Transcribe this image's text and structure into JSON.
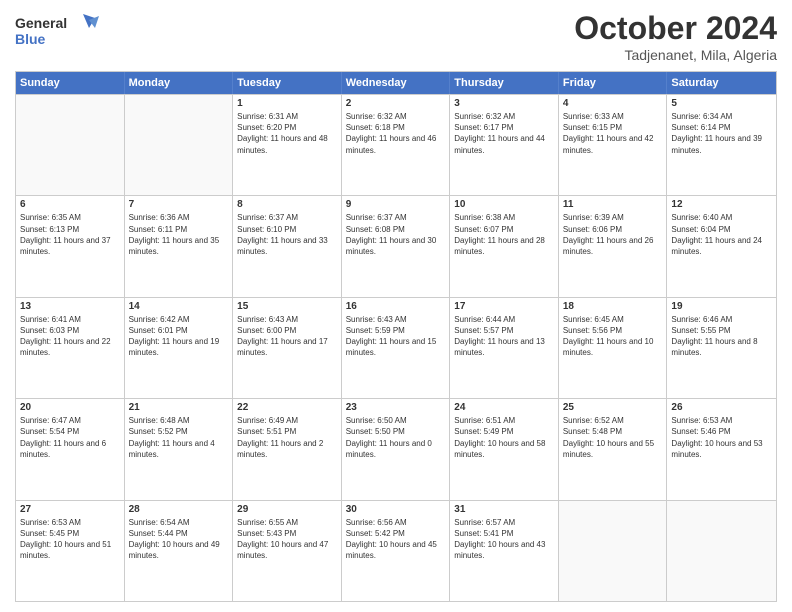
{
  "header": {
    "logo_line1": "General",
    "logo_line2": "Blue",
    "month": "October 2024",
    "location": "Tadjenanet, Mila, Algeria"
  },
  "weekdays": [
    "Sunday",
    "Monday",
    "Tuesday",
    "Wednesday",
    "Thursday",
    "Friday",
    "Saturday"
  ],
  "rows": [
    [
      {
        "day": "",
        "sunrise": "",
        "sunset": "",
        "daylight": ""
      },
      {
        "day": "",
        "sunrise": "",
        "sunset": "",
        "daylight": ""
      },
      {
        "day": "1",
        "sunrise": "Sunrise: 6:31 AM",
        "sunset": "Sunset: 6:20 PM",
        "daylight": "Daylight: 11 hours and 48 minutes."
      },
      {
        "day": "2",
        "sunrise": "Sunrise: 6:32 AM",
        "sunset": "Sunset: 6:18 PM",
        "daylight": "Daylight: 11 hours and 46 minutes."
      },
      {
        "day": "3",
        "sunrise": "Sunrise: 6:32 AM",
        "sunset": "Sunset: 6:17 PM",
        "daylight": "Daylight: 11 hours and 44 minutes."
      },
      {
        "day": "4",
        "sunrise": "Sunrise: 6:33 AM",
        "sunset": "Sunset: 6:15 PM",
        "daylight": "Daylight: 11 hours and 42 minutes."
      },
      {
        "day": "5",
        "sunrise": "Sunrise: 6:34 AM",
        "sunset": "Sunset: 6:14 PM",
        "daylight": "Daylight: 11 hours and 39 minutes."
      }
    ],
    [
      {
        "day": "6",
        "sunrise": "Sunrise: 6:35 AM",
        "sunset": "Sunset: 6:13 PM",
        "daylight": "Daylight: 11 hours and 37 minutes."
      },
      {
        "day": "7",
        "sunrise": "Sunrise: 6:36 AM",
        "sunset": "Sunset: 6:11 PM",
        "daylight": "Daylight: 11 hours and 35 minutes."
      },
      {
        "day": "8",
        "sunrise": "Sunrise: 6:37 AM",
        "sunset": "Sunset: 6:10 PM",
        "daylight": "Daylight: 11 hours and 33 minutes."
      },
      {
        "day": "9",
        "sunrise": "Sunrise: 6:37 AM",
        "sunset": "Sunset: 6:08 PM",
        "daylight": "Daylight: 11 hours and 30 minutes."
      },
      {
        "day": "10",
        "sunrise": "Sunrise: 6:38 AM",
        "sunset": "Sunset: 6:07 PM",
        "daylight": "Daylight: 11 hours and 28 minutes."
      },
      {
        "day": "11",
        "sunrise": "Sunrise: 6:39 AM",
        "sunset": "Sunset: 6:06 PM",
        "daylight": "Daylight: 11 hours and 26 minutes."
      },
      {
        "day": "12",
        "sunrise": "Sunrise: 6:40 AM",
        "sunset": "Sunset: 6:04 PM",
        "daylight": "Daylight: 11 hours and 24 minutes."
      }
    ],
    [
      {
        "day": "13",
        "sunrise": "Sunrise: 6:41 AM",
        "sunset": "Sunset: 6:03 PM",
        "daylight": "Daylight: 11 hours and 22 minutes."
      },
      {
        "day": "14",
        "sunrise": "Sunrise: 6:42 AM",
        "sunset": "Sunset: 6:01 PM",
        "daylight": "Daylight: 11 hours and 19 minutes."
      },
      {
        "day": "15",
        "sunrise": "Sunrise: 6:43 AM",
        "sunset": "Sunset: 6:00 PM",
        "daylight": "Daylight: 11 hours and 17 minutes."
      },
      {
        "day": "16",
        "sunrise": "Sunrise: 6:43 AM",
        "sunset": "Sunset: 5:59 PM",
        "daylight": "Daylight: 11 hours and 15 minutes."
      },
      {
        "day": "17",
        "sunrise": "Sunrise: 6:44 AM",
        "sunset": "Sunset: 5:57 PM",
        "daylight": "Daylight: 11 hours and 13 minutes."
      },
      {
        "day": "18",
        "sunrise": "Sunrise: 6:45 AM",
        "sunset": "Sunset: 5:56 PM",
        "daylight": "Daylight: 11 hours and 10 minutes."
      },
      {
        "day": "19",
        "sunrise": "Sunrise: 6:46 AM",
        "sunset": "Sunset: 5:55 PM",
        "daylight": "Daylight: 11 hours and 8 minutes."
      }
    ],
    [
      {
        "day": "20",
        "sunrise": "Sunrise: 6:47 AM",
        "sunset": "Sunset: 5:54 PM",
        "daylight": "Daylight: 11 hours and 6 minutes."
      },
      {
        "day": "21",
        "sunrise": "Sunrise: 6:48 AM",
        "sunset": "Sunset: 5:52 PM",
        "daylight": "Daylight: 11 hours and 4 minutes."
      },
      {
        "day": "22",
        "sunrise": "Sunrise: 6:49 AM",
        "sunset": "Sunset: 5:51 PM",
        "daylight": "Daylight: 11 hours and 2 minutes."
      },
      {
        "day": "23",
        "sunrise": "Sunrise: 6:50 AM",
        "sunset": "Sunset: 5:50 PM",
        "daylight": "Daylight: 11 hours and 0 minutes."
      },
      {
        "day": "24",
        "sunrise": "Sunrise: 6:51 AM",
        "sunset": "Sunset: 5:49 PM",
        "daylight": "Daylight: 10 hours and 58 minutes."
      },
      {
        "day": "25",
        "sunrise": "Sunrise: 6:52 AM",
        "sunset": "Sunset: 5:48 PM",
        "daylight": "Daylight: 10 hours and 55 minutes."
      },
      {
        "day": "26",
        "sunrise": "Sunrise: 6:53 AM",
        "sunset": "Sunset: 5:46 PM",
        "daylight": "Daylight: 10 hours and 53 minutes."
      }
    ],
    [
      {
        "day": "27",
        "sunrise": "Sunrise: 6:53 AM",
        "sunset": "Sunset: 5:45 PM",
        "daylight": "Daylight: 10 hours and 51 minutes."
      },
      {
        "day": "28",
        "sunrise": "Sunrise: 6:54 AM",
        "sunset": "Sunset: 5:44 PM",
        "daylight": "Daylight: 10 hours and 49 minutes."
      },
      {
        "day": "29",
        "sunrise": "Sunrise: 6:55 AM",
        "sunset": "Sunset: 5:43 PM",
        "daylight": "Daylight: 10 hours and 47 minutes."
      },
      {
        "day": "30",
        "sunrise": "Sunrise: 6:56 AM",
        "sunset": "Sunset: 5:42 PM",
        "daylight": "Daylight: 10 hours and 45 minutes."
      },
      {
        "day": "31",
        "sunrise": "Sunrise: 6:57 AM",
        "sunset": "Sunset: 5:41 PM",
        "daylight": "Daylight: 10 hours and 43 minutes."
      },
      {
        "day": "",
        "sunrise": "",
        "sunset": "",
        "daylight": ""
      },
      {
        "day": "",
        "sunrise": "",
        "sunset": "",
        "daylight": ""
      }
    ]
  ]
}
